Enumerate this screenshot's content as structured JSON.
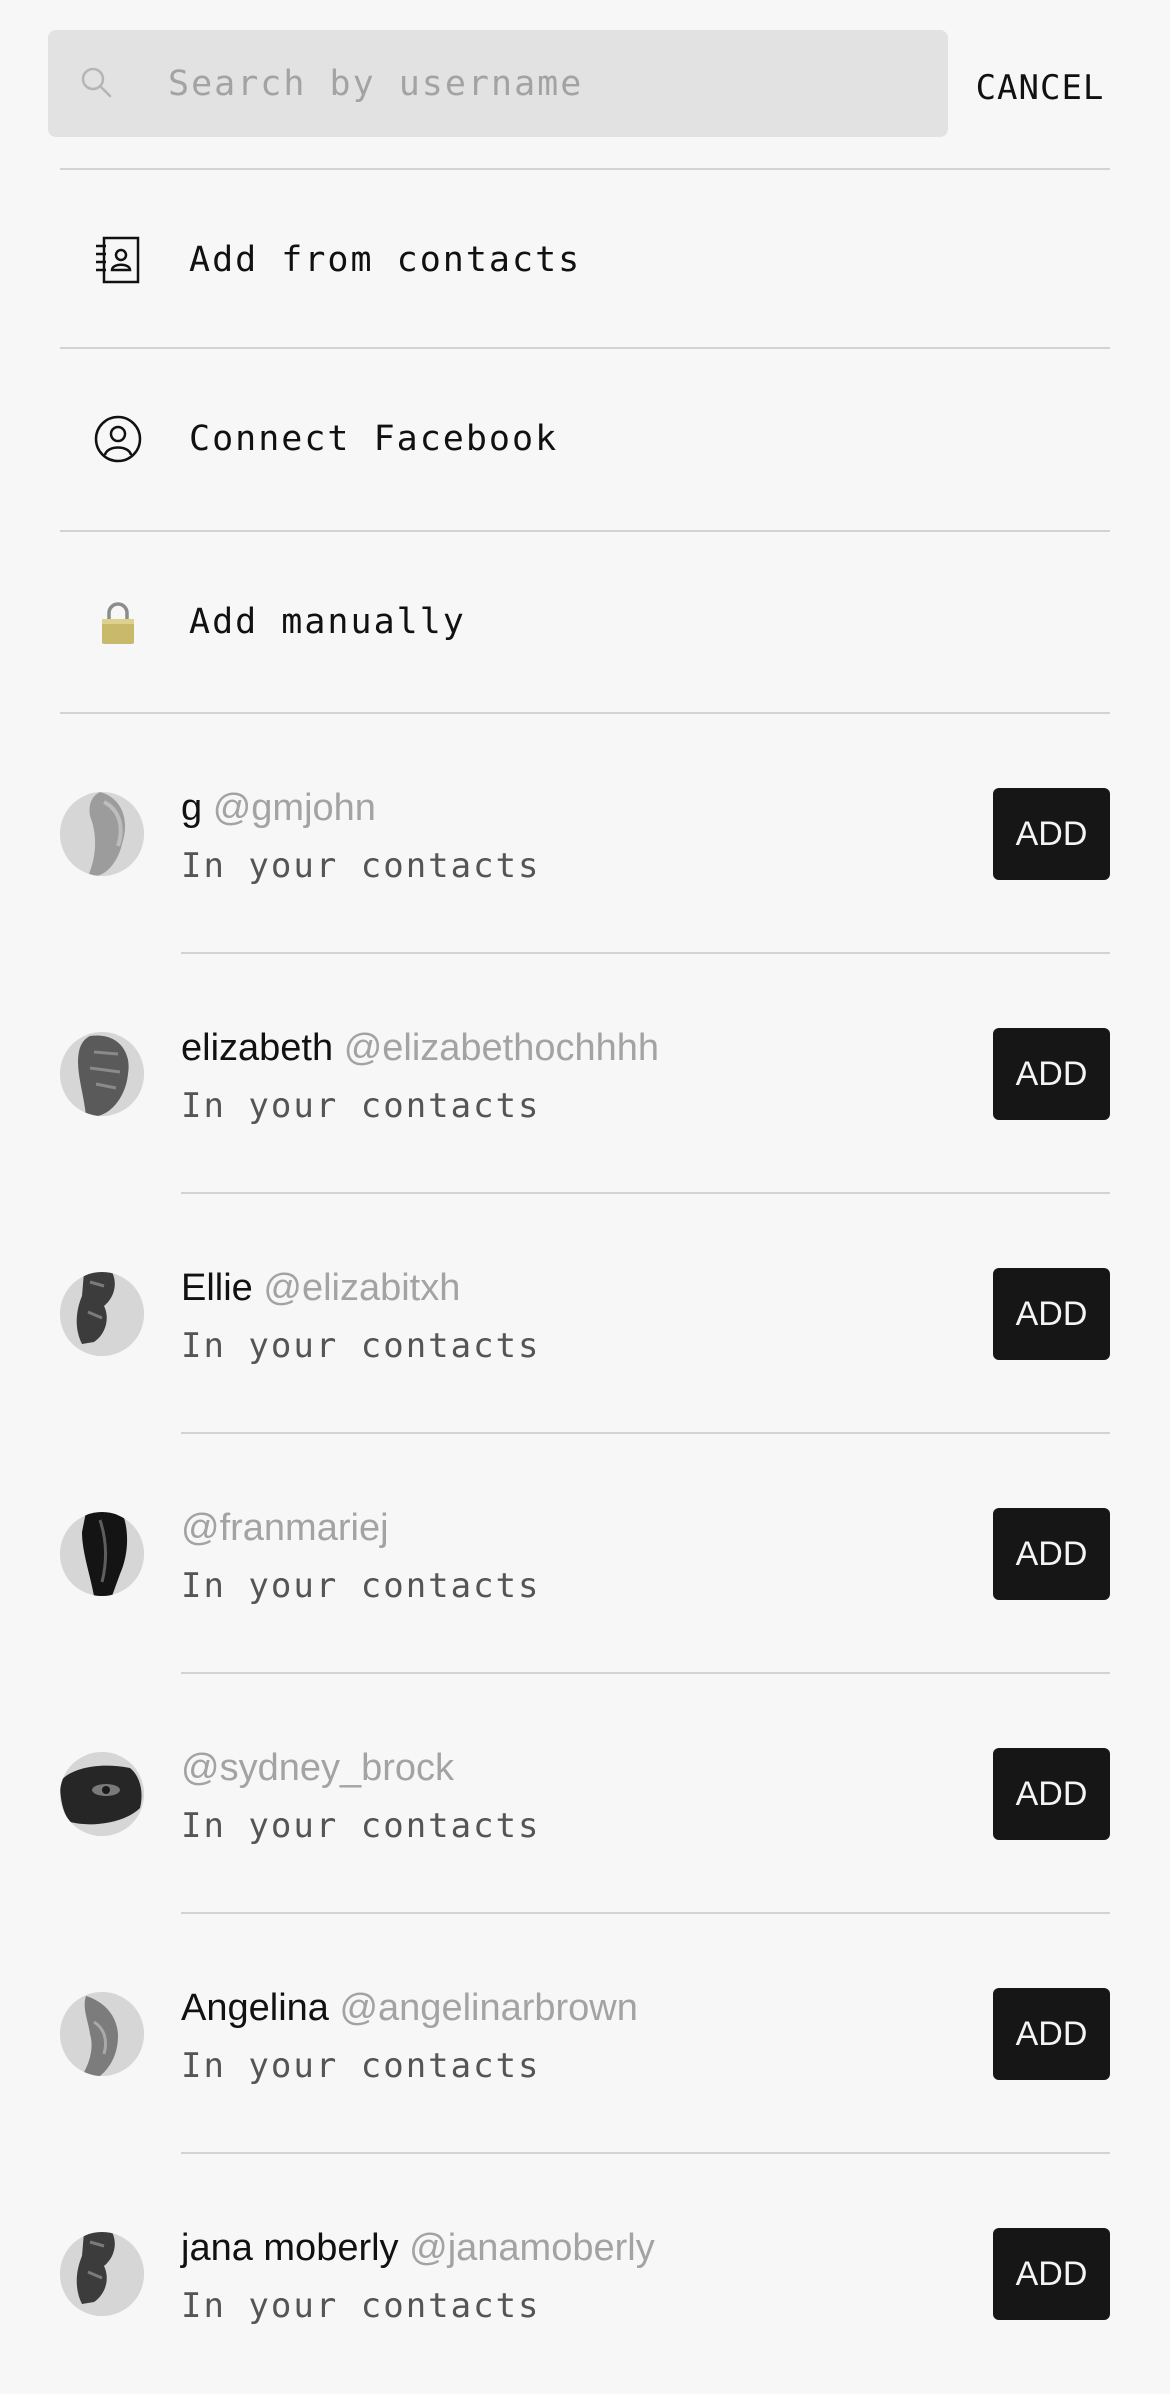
{
  "search": {
    "placeholder": "Search by username",
    "value": "",
    "cancel_label": "CANCEL"
  },
  "options": [
    {
      "label": "Add from contacts",
      "icon": "contacts-book-icon"
    },
    {
      "label": "Connect Facebook",
      "icon": "user-circle-icon"
    },
    {
      "label": "Add manually",
      "icon": "lock-icon"
    }
  ],
  "contacts": [
    {
      "display_name": "g",
      "username": "@gmjohn",
      "status": "In your contacts",
      "add_label": "ADD"
    },
    {
      "display_name": "elizabeth",
      "username": "@elizabethochhhh",
      "status": "In your contacts",
      "add_label": "ADD"
    },
    {
      "display_name": "Ellie",
      "username": "@elizabitxh",
      "status": "In your contacts",
      "add_label": "ADD"
    },
    {
      "display_name": "",
      "username": "@franmariej",
      "status": "In your contacts",
      "add_label": "ADD"
    },
    {
      "display_name": "",
      "username": "@sydney_brock",
      "status": "In your contacts",
      "add_label": "ADD"
    },
    {
      "display_name": "Angelina",
      "username": "@angelinarbrown",
      "status": "In your contacts",
      "add_label": "ADD"
    },
    {
      "display_name": "jana moberly",
      "username": "@janamoberly",
      "status": "In your contacts",
      "add_label": "ADD"
    }
  ],
  "colors": {
    "background": "#f7f7f7",
    "search_field": "#e2e2e2",
    "button": "#161616",
    "muted_text": "#a3a3a3",
    "divider": "#d3d3d3"
  }
}
